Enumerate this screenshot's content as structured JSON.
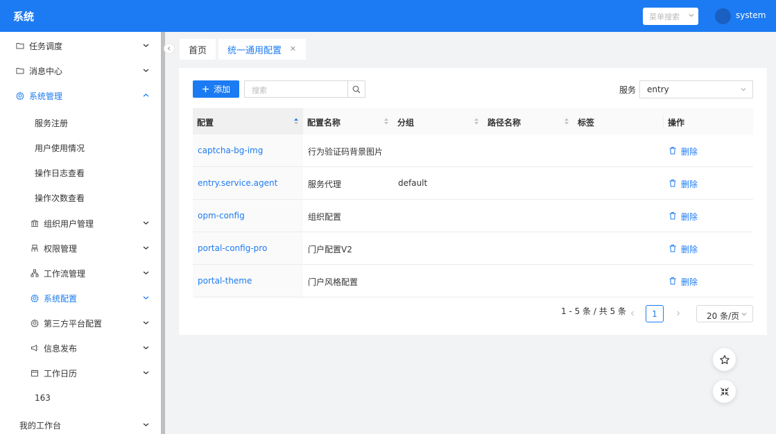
{
  "header": {
    "title": "系统",
    "menu_search_placeholder": "菜单搜索",
    "username": "system"
  },
  "sidebar": {
    "items": [
      {
        "label": "任务调度",
        "icon": "folder-icon"
      },
      {
        "label": "消息中心",
        "icon": "folder-icon"
      },
      {
        "label": "系统管理",
        "icon": "gear-icon",
        "active": true
      },
      {
        "label": "服务注册"
      },
      {
        "label": "用户使用情况"
      },
      {
        "label": "操作日志查看"
      },
      {
        "label": "操作次数查看"
      },
      {
        "label": "组织用户管理",
        "icon": "bank-icon"
      },
      {
        "label": "权限管理",
        "icon": "user-lock-icon"
      },
      {
        "label": "工作流管理",
        "icon": "cluster-icon"
      },
      {
        "label": "系统配置",
        "icon": "gear-icon",
        "active": true
      },
      {
        "label": "第三方平台配置",
        "icon": "gear-icon"
      },
      {
        "label": "信息发布",
        "icon": "megaphone-icon"
      },
      {
        "label": "工作日历",
        "icon": "calendar-icon"
      },
      {
        "label": "163"
      },
      {
        "label": "我的工作台"
      }
    ]
  },
  "tabs": [
    {
      "label": "首页"
    },
    {
      "label": "统一通用配置",
      "closable": true
    }
  ],
  "toolbar": {
    "add_label": "添加",
    "search_placeholder": "搜索",
    "service_label": "服务",
    "service_value": "entry"
  },
  "table": {
    "columns": [
      "配置",
      "配置名称",
      "分组",
      "路径名称",
      "标签",
      "操作"
    ],
    "rows": [
      {
        "key": "captcha-bg-img",
        "name": "行为验证码背景图片",
        "group": "",
        "path": "",
        "tag": "",
        "action": "删除"
      },
      {
        "key": "entry.service.agent",
        "name": "服务代理",
        "group": "default",
        "path": "",
        "tag": "",
        "action": "删除"
      },
      {
        "key": "opm-config",
        "name": "组织配置",
        "group": "",
        "path": "",
        "tag": "",
        "action": "删除"
      },
      {
        "key": "portal-config-pro",
        "name": "门户配置V2",
        "group": "",
        "path": "",
        "tag": "",
        "action": "删除"
      },
      {
        "key": "portal-theme",
        "name": "门户风格配置",
        "group": "",
        "path": "",
        "tag": "",
        "action": "删除"
      }
    ]
  },
  "pagination": {
    "summary": "1 - 5 条 / 共 5 条",
    "current_page": "1",
    "page_size": "20 条/页"
  },
  "colors": {
    "primary": "#1c7bf2",
    "header_bg": "#1c7bf2"
  }
}
